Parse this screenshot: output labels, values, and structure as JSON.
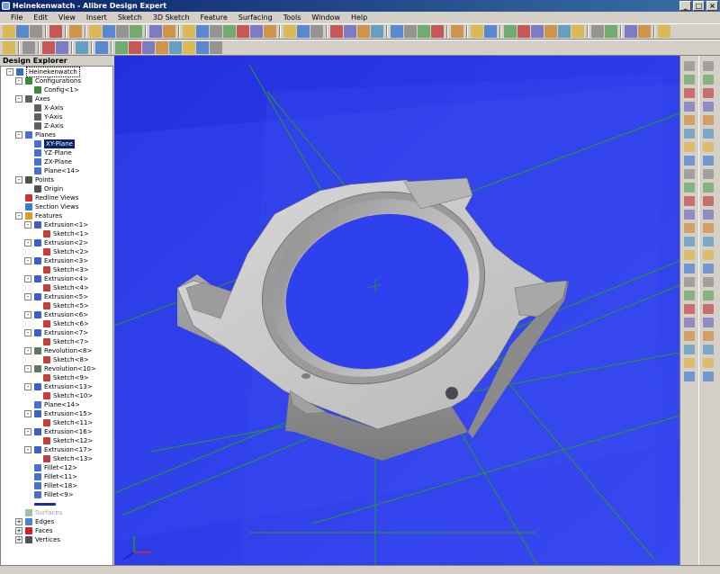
{
  "window": {
    "title": "Heinekenwatch - Alibre Design Expert"
  },
  "menu": [
    "File",
    "Edit",
    "View",
    "Insert",
    "Sketch",
    "3D Sketch",
    "Feature",
    "Surfacing",
    "Tools",
    "Window",
    "Help"
  ],
  "explorer": {
    "title": "Design Explorer"
  },
  "tree": [
    {
      "label": "Heinekenwatch",
      "level": 0,
      "exp": "-",
      "icon": "part-icon",
      "style": "box"
    },
    {
      "label": "Configurations",
      "level": 1,
      "exp": "-",
      "icon": "config-icon"
    },
    {
      "label": "Config<1>",
      "level": 2,
      "exp": "",
      "icon": "config-icon"
    },
    {
      "label": "Axes",
      "level": 1,
      "exp": "-",
      "icon": "axis-icon"
    },
    {
      "label": "X-Axis",
      "level": 2,
      "exp": "",
      "icon": "axis-icon"
    },
    {
      "label": "Y-Axis",
      "level": 2,
      "exp": "",
      "icon": "axis-icon"
    },
    {
      "label": "Z-Axis",
      "level": 2,
      "exp": "",
      "icon": "axis-icon"
    },
    {
      "label": "Planes",
      "level": 1,
      "exp": "-",
      "icon": "plane-icon"
    },
    {
      "label": "XY-Plane",
      "level": 2,
      "exp": "",
      "icon": "plane-icon",
      "style": "sel"
    },
    {
      "label": "YZ-Plane",
      "level": 2,
      "exp": "",
      "icon": "plane-icon"
    },
    {
      "label": "ZX-Plane",
      "level": 2,
      "exp": "",
      "icon": "plane-icon"
    },
    {
      "label": "Plane<14>",
      "level": 2,
      "exp": "",
      "icon": "plane-icon"
    },
    {
      "label": "Points",
      "level": 1,
      "exp": "-",
      "icon": "point-icon"
    },
    {
      "label": "Origin",
      "level": 2,
      "exp": "",
      "icon": "point-icon"
    },
    {
      "label": "Redline Views",
      "level": 1,
      "exp": "",
      "icon": "redline-icon"
    },
    {
      "label": "Section Views",
      "level": 1,
      "exp": "",
      "icon": "section-icon"
    },
    {
      "label": "Features",
      "level": 1,
      "exp": "-",
      "icon": "features-icon"
    },
    {
      "label": "Extrusion<1>",
      "level": 2,
      "exp": "-",
      "icon": "extrusion-icon"
    },
    {
      "label": "Sketch<1>",
      "level": 3,
      "exp": "",
      "icon": "sketch-icon"
    },
    {
      "label": "Extrusion<2>",
      "level": 2,
      "exp": "-",
      "icon": "extrusion-icon"
    },
    {
      "label": "Sketch<2>",
      "level": 3,
      "exp": "",
      "icon": "sketch-icon"
    },
    {
      "label": "Extrusion<3>",
      "level": 2,
      "exp": "-",
      "icon": "extrusion-icon"
    },
    {
      "label": "Sketch<3>",
      "level": 3,
      "exp": "",
      "icon": "sketch-icon"
    },
    {
      "label": "Extrusion<4>",
      "level": 2,
      "exp": "-",
      "icon": "extrusion-icon"
    },
    {
      "label": "Sketch<4>",
      "level": 3,
      "exp": "",
      "icon": "sketch-icon"
    },
    {
      "label": "Extrusion<5>",
      "level": 2,
      "exp": "-",
      "icon": "extrusion-icon"
    },
    {
      "label": "Sketch<5>",
      "level": 3,
      "exp": "",
      "icon": "sketch-icon"
    },
    {
      "label": "Extrusion<6>",
      "level": 2,
      "exp": "-",
      "icon": "extrusion-icon"
    },
    {
      "label": "Sketch<6>",
      "level": 3,
      "exp": "",
      "icon": "sketch-icon"
    },
    {
      "label": "Extrusion<7>",
      "level": 2,
      "exp": "-",
      "icon": "extrusion-icon"
    },
    {
      "label": "Sketch<7>",
      "level": 3,
      "exp": "",
      "icon": "sketch-icon"
    },
    {
      "label": "Revolution<8>",
      "level": 2,
      "exp": "-",
      "icon": "revolution-icon"
    },
    {
      "label": "Sketch<8>",
      "level": 3,
      "exp": "",
      "icon": "sketch-icon"
    },
    {
      "label": "Revolution<10>",
      "level": 2,
      "exp": "-",
      "icon": "revolution-icon"
    },
    {
      "label": "Sketch<9>",
      "level": 3,
      "exp": "",
      "icon": "sketch-icon"
    },
    {
      "label": "Extrusion<13>",
      "level": 2,
      "exp": "-",
      "icon": "extrusion-icon"
    },
    {
      "label": "Sketch<10>",
      "level": 3,
      "exp": "",
      "icon": "sketch-icon"
    },
    {
      "label": "Plane<14>",
      "level": 2,
      "exp": "",
      "icon": "plane-icon"
    },
    {
      "label": "Extrusion<15>",
      "level": 2,
      "exp": "-",
      "icon": "extrusion-icon"
    },
    {
      "label": "Sketch<11>",
      "level": 3,
      "exp": "",
      "icon": "sketch-icon"
    },
    {
      "label": "Extrusion<16>",
      "level": 2,
      "exp": "-",
      "icon": "extrusion-icon"
    },
    {
      "label": "Sketch<12>",
      "level": 3,
      "exp": "",
      "icon": "sketch-icon"
    },
    {
      "label": "Extrusion<17>",
      "level": 2,
      "exp": "-",
      "icon": "extrusion-icon"
    },
    {
      "label": "Sketch<13>",
      "level": 3,
      "exp": "",
      "icon": "sketch-icon"
    },
    {
      "label": "Fillet<12>",
      "level": 2,
      "exp": "",
      "icon": "fillet-icon"
    },
    {
      "label": "Fillet<11>",
      "level": 2,
      "exp": "",
      "icon": "fillet-icon"
    },
    {
      "label": "Fillet<18>",
      "level": 2,
      "exp": "",
      "icon": "fillet-icon"
    },
    {
      "label": "Fillet<9>",
      "level": 2,
      "exp": "",
      "icon": "fillet-icon"
    },
    {
      "label": "",
      "level": 2,
      "exp": "",
      "icon": "end-of-part-marker-icon"
    },
    {
      "label": "Surfaces",
      "level": 1,
      "exp": "",
      "icon": "surface-icon",
      "style": "dim"
    },
    {
      "label": "Edges",
      "level": 1,
      "exp": "+",
      "icon": "edge-icon"
    },
    {
      "label": "Faces",
      "level": 1,
      "exp": "+",
      "icon": "face-icon"
    },
    {
      "label": "Vertices",
      "level": 1,
      "exp": "+",
      "icon": "vertex-icon"
    }
  ],
  "icon_colors": {
    "part-icon": "#2e6fc0",
    "config-icon": "#3a8a3a",
    "axis-icon": "#606060",
    "plane-icon": "#4a6fd0",
    "point-icon": "#505050",
    "redline-icon": "#d03030",
    "section-icon": "#3a7ad0",
    "features-icon": "#d0a020",
    "extrusion-icon": "#4060c0",
    "sketch-icon": "#c04040",
    "revolution-icon": "#5a7a5a",
    "fillet-icon": "#4a70c8",
    "end-of-part-marker-icon": "#1a2aa0",
    "surface-icon": "#a0c0a0",
    "edge-icon": "#5080d0",
    "face-icon": "#d02020",
    "vertex-icon": "#505050"
  },
  "toolbar1_icons": [
    "part-icon",
    "open-icon",
    "save-icon",
    "sep",
    "copy-icon",
    "sep",
    "print-icon",
    "sep",
    "cut-icon",
    "copy-icon",
    "paste-icon",
    "delete-icon",
    "sep",
    "undo-icon",
    "redo-icon",
    "sep",
    "view-front-icon",
    "view-back-icon",
    "view-top-icon",
    "view-bottom-icon",
    "view-left-icon",
    "view-right-icon",
    "view-iso-icon",
    "sep",
    "box-icon",
    "box-icon",
    "box-icon",
    "sep",
    "extrude-icon",
    "revolve-icon",
    "sweep-icon",
    "loft-icon",
    "sep",
    "sketch-icon",
    "move-icon",
    "mirror-icon",
    "pattern-icon",
    "sep",
    "measure-icon",
    "sep",
    "pencil-icon",
    "select-icon",
    "sep",
    "arrow-icon",
    "pan-icon",
    "rotate-icon",
    "zoom-icon",
    "zoom-in-icon",
    "zoom-out-icon",
    "sep",
    "prev-view-icon",
    "next-view-icon",
    "sep",
    "render-icon",
    "shaded-icon",
    "sep",
    "help-icon"
  ],
  "toolbar2_icons": [
    "grid-icon",
    "sep",
    "snap-icon",
    "sep",
    "layers-icon",
    "layer-icon",
    "sep",
    "color-icon",
    "sep",
    "display-icon",
    "sep",
    "sketch-tool-1-icon",
    "sketch-tool-2-icon",
    "sketch-tool-3-icon",
    "sketch-tool-4-icon",
    "sketch-tool-5-icon",
    "sketch-tool-6-icon",
    "sketch-tool-7-icon",
    "sketch-tool-8-icon"
  ],
  "viewport": {
    "background": "#2b38e8",
    "model_color": "#c8c8c8",
    "plane_edge_color": "#1fa01f"
  }
}
